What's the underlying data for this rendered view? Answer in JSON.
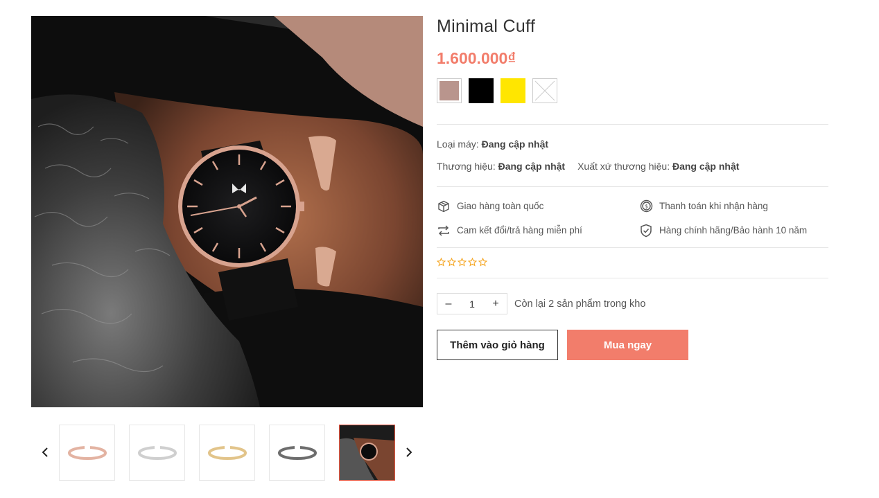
{
  "product": {
    "title": "Minimal Cuff",
    "price": "1.600.000₫",
    "swatches": [
      {
        "name": "rose",
        "color": "#b9958d"
      },
      {
        "name": "black",
        "color": "#000000"
      },
      {
        "name": "yellow",
        "color": "#ffe600"
      },
      {
        "name": "unavailable",
        "color": "#ffffff"
      }
    ],
    "meta": {
      "movement_label": "Loại máy:",
      "movement_value": "Đang cập nhật",
      "brand_label": "Thương hiệu:",
      "brand_value": "Đang cập nhật",
      "origin_label": "Xuất xứ thương hiệu:",
      "origin_value": "Đang cập nhật"
    },
    "policies": [
      {
        "icon": "box-icon",
        "label": "Giao hàng toàn quốc"
      },
      {
        "icon": "coin-icon",
        "label": "Thanh toán khi nhận hàng"
      },
      {
        "icon": "exchange-icon",
        "label": "Cam kết đổi/trả hàng miễn phí"
      },
      {
        "icon": "shield-check-icon",
        "label": "Hàng chính hãng/Bảo hành 10 năm"
      }
    ],
    "rating": {
      "stars_filled": 0,
      "stars_total": 5
    },
    "quantity": {
      "minus": "–",
      "value": "1",
      "plus": "+"
    },
    "stock_text": "Còn lại 2 sản phẩm trong kho",
    "buttons": {
      "add_to_cart": "Thêm vào giỏ hàng",
      "buy_now": "Mua ngay"
    }
  },
  "gallery": {
    "thumbs": [
      {
        "name": "rose-gold-cuff",
        "color": "#e3b3a2"
      },
      {
        "name": "silver-cuff",
        "color": "#cfcfcf"
      },
      {
        "name": "gold-cuff",
        "color": "#e2c48a"
      },
      {
        "name": "gunmetal-cuff",
        "color": "#6d6d6d"
      },
      {
        "name": "wrist-watch-photo",
        "color": "#1c1c1c"
      }
    ],
    "active_index": 4
  },
  "colors": {
    "accent": "#f27d6b",
    "text": "#333333",
    "active_border": "#e5533d"
  }
}
